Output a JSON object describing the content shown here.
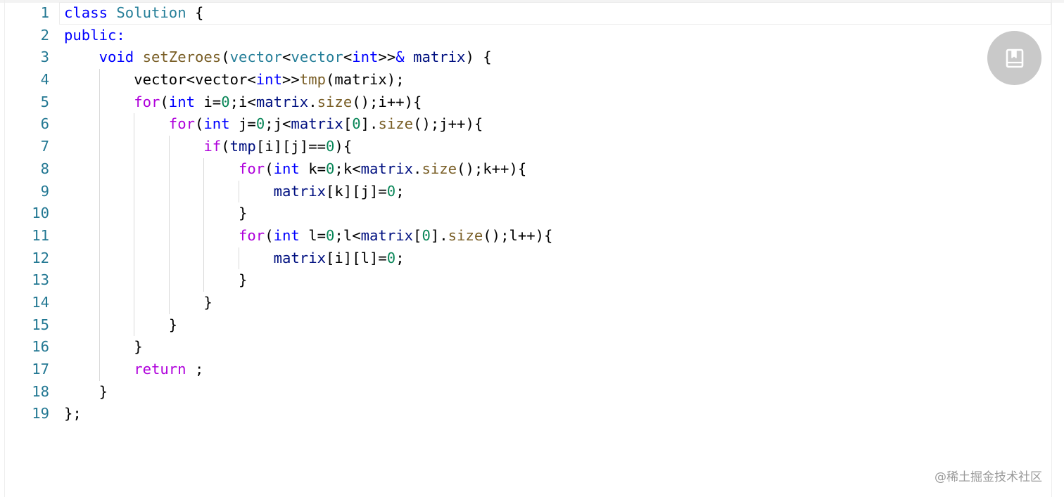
{
  "editor": {
    "lines": [
      {
        "number": "1",
        "indent": 0,
        "tokens": [
          {
            "t": "class",
            "c": "kw"
          },
          {
            "t": " ",
            "c": "pl"
          },
          {
            "t": "Solution",
            "c": "type"
          },
          {
            "t": " {",
            "c": "pl"
          }
        ]
      },
      {
        "number": "2",
        "indent": 0,
        "tokens": [
          {
            "t": "public",
            "c": "kw"
          },
          {
            "t": ":",
            "c": "kw"
          }
        ]
      },
      {
        "number": "3",
        "indent": 1,
        "tokens": [
          {
            "t": "void",
            "c": "kw"
          },
          {
            "t": " ",
            "c": "pl"
          },
          {
            "t": "setZeroes",
            "c": "fn"
          },
          {
            "t": "(",
            "c": "pl"
          },
          {
            "t": "vector",
            "c": "type"
          },
          {
            "t": "<",
            "c": "pl"
          },
          {
            "t": "vector",
            "c": "type"
          },
          {
            "t": "<",
            "c": "pl"
          },
          {
            "t": "int",
            "c": "kw"
          },
          {
            "t": ">>",
            "c": "pl"
          },
          {
            "t": "&",
            "c": "kw"
          },
          {
            "t": " ",
            "c": "pl"
          },
          {
            "t": "matrix",
            "c": "var"
          },
          {
            "t": ") {",
            "c": "pl"
          }
        ]
      },
      {
        "number": "4",
        "indent": 2,
        "tokens": [
          {
            "t": "vector<vector<",
            "c": "pl"
          },
          {
            "t": "int",
            "c": "kw"
          },
          {
            "t": ">>",
            "c": "pl"
          },
          {
            "t": "tmp",
            "c": "fn"
          },
          {
            "t": "(matrix);",
            "c": "pl"
          }
        ]
      },
      {
        "number": "5",
        "indent": 2,
        "tokens": [
          {
            "t": "for",
            "c": "ctl"
          },
          {
            "t": "(",
            "c": "pl"
          },
          {
            "t": "int",
            "c": "kw"
          },
          {
            "t": " i=",
            "c": "pl"
          },
          {
            "t": "0",
            "c": "num"
          },
          {
            "t": ";i<",
            "c": "pl"
          },
          {
            "t": "matrix",
            "c": "var"
          },
          {
            "t": ".",
            "c": "pl"
          },
          {
            "t": "size",
            "c": "fn"
          },
          {
            "t": "();i++){",
            "c": "pl"
          }
        ]
      },
      {
        "number": "6",
        "indent": 3,
        "tokens": [
          {
            "t": "for",
            "c": "ctl"
          },
          {
            "t": "(",
            "c": "pl"
          },
          {
            "t": "int",
            "c": "kw"
          },
          {
            "t": " j=",
            "c": "pl"
          },
          {
            "t": "0",
            "c": "num"
          },
          {
            "t": ";j<",
            "c": "pl"
          },
          {
            "t": "matrix",
            "c": "var"
          },
          {
            "t": "[",
            "c": "pl"
          },
          {
            "t": "0",
            "c": "num"
          },
          {
            "t": "].",
            "c": "pl"
          },
          {
            "t": "size",
            "c": "fn"
          },
          {
            "t": "();j++){",
            "c": "pl"
          }
        ]
      },
      {
        "number": "7",
        "indent": 4,
        "tokens": [
          {
            "t": "if",
            "c": "ctl"
          },
          {
            "t": "(",
            "c": "pl"
          },
          {
            "t": "tmp",
            "c": "var"
          },
          {
            "t": "[i][j]==",
            "c": "pl"
          },
          {
            "t": "0",
            "c": "num"
          },
          {
            "t": "){",
            "c": "pl"
          }
        ]
      },
      {
        "number": "8",
        "indent": 5,
        "tokens": [
          {
            "t": "for",
            "c": "ctl"
          },
          {
            "t": "(",
            "c": "pl"
          },
          {
            "t": "int",
            "c": "kw"
          },
          {
            "t": " k=",
            "c": "pl"
          },
          {
            "t": "0",
            "c": "num"
          },
          {
            "t": ";k<",
            "c": "pl"
          },
          {
            "t": "matrix",
            "c": "var"
          },
          {
            "t": ".",
            "c": "pl"
          },
          {
            "t": "size",
            "c": "fn"
          },
          {
            "t": "();k++){",
            "c": "pl"
          }
        ]
      },
      {
        "number": "9",
        "indent": 6,
        "tokens": [
          {
            "t": "matrix",
            "c": "var"
          },
          {
            "t": "[k][j]=",
            "c": "pl"
          },
          {
            "t": "0",
            "c": "num"
          },
          {
            "t": ";",
            "c": "pl"
          }
        ]
      },
      {
        "number": "10",
        "indent": 5,
        "tokens": [
          {
            "t": "}",
            "c": "pl"
          }
        ]
      },
      {
        "number": "11",
        "indent": 5,
        "tokens": [
          {
            "t": "for",
            "c": "ctl"
          },
          {
            "t": "(",
            "c": "pl"
          },
          {
            "t": "int",
            "c": "kw"
          },
          {
            "t": " l=",
            "c": "pl"
          },
          {
            "t": "0",
            "c": "num"
          },
          {
            "t": ";l<",
            "c": "pl"
          },
          {
            "t": "matrix",
            "c": "var"
          },
          {
            "t": "[",
            "c": "pl"
          },
          {
            "t": "0",
            "c": "num"
          },
          {
            "t": "].",
            "c": "pl"
          },
          {
            "t": "size",
            "c": "fn"
          },
          {
            "t": "();l++){",
            "c": "pl"
          }
        ]
      },
      {
        "number": "12",
        "indent": 6,
        "tokens": [
          {
            "t": "matrix",
            "c": "var"
          },
          {
            "t": "[i][l]=",
            "c": "pl"
          },
          {
            "t": "0",
            "c": "num"
          },
          {
            "t": ";",
            "c": "pl"
          }
        ]
      },
      {
        "number": "13",
        "indent": 5,
        "tokens": [
          {
            "t": "}",
            "c": "pl"
          }
        ]
      },
      {
        "number": "14",
        "indent": 4,
        "tokens": [
          {
            "t": "}",
            "c": "pl"
          }
        ]
      },
      {
        "number": "15",
        "indent": 3,
        "tokens": [
          {
            "t": "}",
            "c": "pl"
          }
        ]
      },
      {
        "number": "16",
        "indent": 2,
        "tokens": [
          {
            "t": "}",
            "c": "pl"
          }
        ]
      },
      {
        "number": "17",
        "indent": 2,
        "tokens": [
          {
            "t": "return",
            "c": "ctl"
          },
          {
            "t": " ;",
            "c": "pl"
          }
        ]
      },
      {
        "number": "18",
        "indent": 1,
        "tokens": [
          {
            "t": "}",
            "c": "pl"
          }
        ]
      },
      {
        "number": "19",
        "indent": 0,
        "tokens": [
          {
            "t": "};",
            "c": "pl"
          }
        ]
      }
    ]
  },
  "bookmark_button": {
    "icon": "bookmark-icon"
  },
  "watermark": {
    "text": "@稀土掘金技术社区"
  },
  "colors": {
    "keyword": "#0000ff",
    "control": "#af00db",
    "type": "#267f99",
    "function": "#795e26",
    "variable": "#001080",
    "number": "#098658",
    "line_number": "#237893",
    "fab_background": "#c9c9c9"
  }
}
